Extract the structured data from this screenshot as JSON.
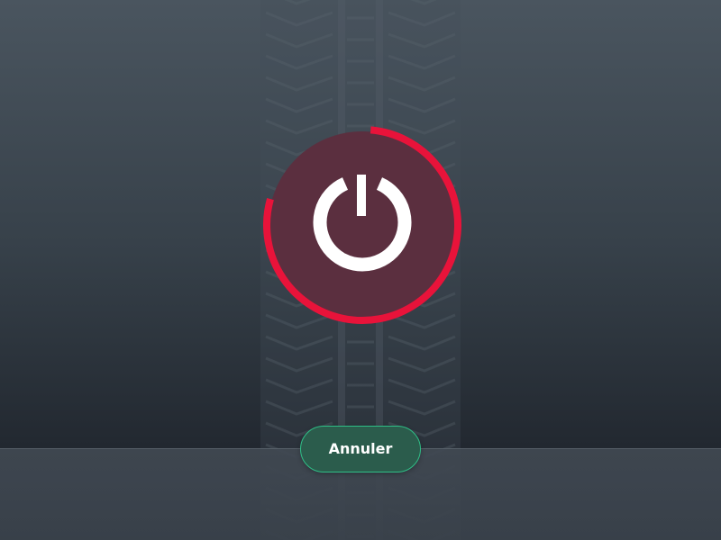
{
  "dialog": {
    "cancel_label": "Annuler"
  },
  "power": {
    "icon": "power-icon",
    "progress": 0.78
  },
  "colors": {
    "accent_red": "#e8133a",
    "button_border": "#2fbf87",
    "button_fill": "#2b5c4c",
    "circle_fill": "#5b2f3f"
  }
}
